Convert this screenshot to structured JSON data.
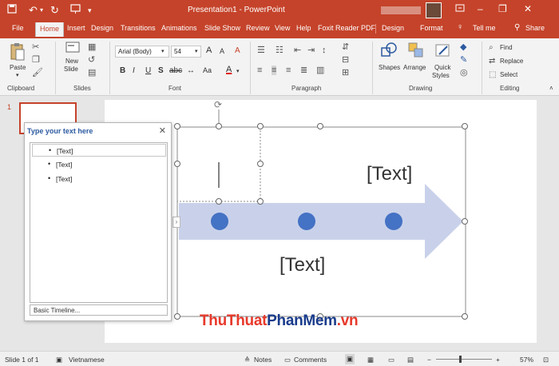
{
  "title_bar": {
    "title": "Presentation1  -  PowerPoint",
    "icons": [
      "save-icon",
      "undo-icon",
      "redo-icon",
      "present-icon",
      "customize-qat-icon",
      "ribbon-display-icon",
      "minimize-icon",
      "restore-icon",
      "close-icon"
    ]
  },
  "tabs": [
    "File",
    "Home",
    "Insert",
    "Design",
    "Transitions",
    "Animations",
    "Slide Show",
    "Review",
    "View",
    "Help",
    "Foxit Reader PDF",
    "Design",
    "Format"
  ],
  "active_tab": "Home",
  "tell_me": "Tell me",
  "share": "Share",
  "ribbon": {
    "clipboard": {
      "label": "Clipboard",
      "paste": "Paste"
    },
    "slides": {
      "label": "Slides",
      "new_slide_1": "New",
      "new_slide_2": "Slide"
    },
    "font": {
      "label": "Font",
      "font_name": "Arial (Body)",
      "font_size": "54",
      "bold": "B",
      "italic": "I",
      "underline": "U",
      "strike": "S",
      "grow": "A",
      "shrink": "A",
      "clear": "A",
      "font_color": "A",
      "aa": "Aa"
    },
    "paragraph": {
      "label": "Paragraph"
    },
    "drawing": {
      "label": "Drawing",
      "shapes": "Shapes",
      "arrange": "Arrange",
      "quick_styles_1": "Quick",
      "quick_styles_2": "Styles"
    },
    "editing": {
      "label": "Editing",
      "find": "Find",
      "replace": "Replace",
      "select": "Select"
    }
  },
  "slide_panel": {
    "slide_number": "1"
  },
  "text_pane": {
    "header": "Type your text here",
    "items": [
      "[Text]",
      "[Text]",
      "[Text]"
    ],
    "footer": "Basic Timeline..."
  },
  "slide": {
    "text_top": "[Text]",
    "text_bottom": "[Text]",
    "arrow_color": "#c9d1ea",
    "dot_color": "#4472c4"
  },
  "status_bar": {
    "slide_info": "Slide 1 of 1",
    "language": "Vietnamese",
    "notes": "Notes",
    "comments": "Comments",
    "zoom": "57%"
  },
  "watermark": {
    "part1": "ThuThuat",
    "part2": "PhanMem",
    "part3": ".vn"
  }
}
